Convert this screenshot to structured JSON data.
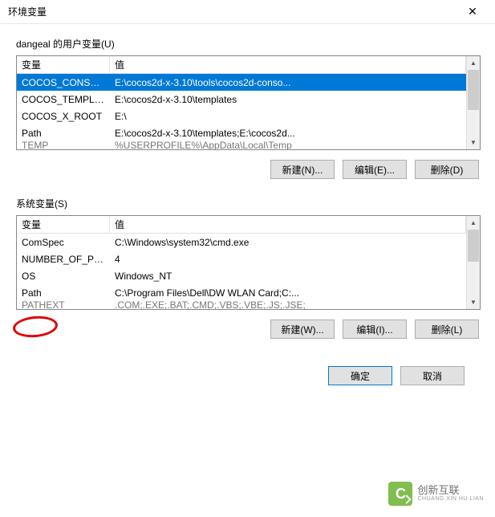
{
  "titlebar": {
    "title": "环境变量"
  },
  "user_section": {
    "label": "dangeal 的用户变量(U)",
    "col_name": "变量",
    "col_value": "值",
    "rows": [
      {
        "name": "COCOS_CONSOL...",
        "value": "E:\\cocos2d-x-3.10\\tools\\cocos2d-conso...",
        "selected": true
      },
      {
        "name": "COCOS_TEMPLA...",
        "value": "E:\\cocos2d-x-3.10\\templates",
        "selected": false
      },
      {
        "name": "COCOS_X_ROOT",
        "value": "E:\\",
        "selected": false
      },
      {
        "name": "Path",
        "value": "E:\\cocos2d-x-3.10\\templates;E:\\cocos2d...",
        "selected": false
      },
      {
        "name": "TEMP",
        "value": "%USERPROFILE%\\AppData\\Local\\Temp",
        "selected": false
      }
    ],
    "buttons": {
      "new": "新建(N)...",
      "edit": "编辑(E)...",
      "delete": "删除(D)"
    }
  },
  "system_section": {
    "label": "系统变量(S)",
    "col_name": "变量",
    "col_value": "值",
    "rows": [
      {
        "name": "ComSpec",
        "value": "C:\\Windows\\system32\\cmd.exe"
      },
      {
        "name": "NUMBER_OF_PR...",
        "value": "4"
      },
      {
        "name": "OS",
        "value": "Windows_NT"
      },
      {
        "name": "Path",
        "value": "C:\\Program Files\\Dell\\DW WLAN Card;C:..."
      },
      {
        "name": "PATHEXT",
        "value": ".COM;.EXE;.BAT;.CMD;.VBS;.VBE;.JS;.JSE;"
      }
    ],
    "buttons": {
      "new": "新建(W)...",
      "edit": "编辑(I)...",
      "delete": "删除(L)"
    }
  },
  "footer": {
    "ok": "确定",
    "cancel": "取消"
  },
  "watermark": {
    "logo": "C",
    "cn": "创新互联",
    "en": "CHUANG XIN HU LIAN"
  }
}
